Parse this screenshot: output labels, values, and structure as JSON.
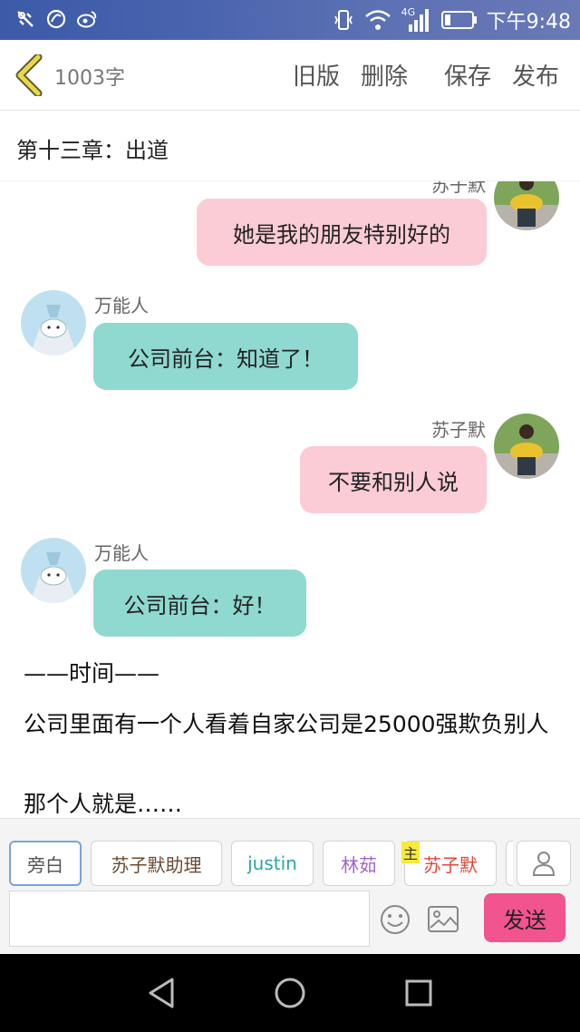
{
  "status_bar": {
    "network_label": "4G",
    "time": "下午9:48"
  },
  "header": {
    "word_count": "1003字",
    "actions": {
      "old_version": "旧版",
      "delete": "删除",
      "save": "保存",
      "publish": "发布"
    }
  },
  "chapter": {
    "title": "第十三章：出道"
  },
  "messages": [
    {
      "side": "right",
      "name": "苏子默",
      "text": "她是我的朋友特别好的"
    },
    {
      "side": "left",
      "name": "万能人",
      "text": "公司前台：知道了！"
    },
    {
      "side": "right",
      "name": "苏子默",
      "text": "不要和别人说"
    },
    {
      "side": "left",
      "name": "万能人",
      "text": "公司前台：好！"
    }
  ],
  "narration": [
    "——时间——",
    "公司里面有一个人看着自家公司是25000强欺负别人",
    "那个人就是……"
  ],
  "roles": [
    {
      "label": "旁白"
    },
    {
      "label": "苏子默助理"
    },
    {
      "label": "justin"
    },
    {
      "label": "林茹"
    },
    {
      "label": "苏子默"
    }
  ],
  "host_badge": "主",
  "send_label": "发送",
  "colors": {
    "pink_bubble": "#fbccd6",
    "teal_bubble": "#8fd9d0",
    "send_button": "#f2548f",
    "active_role_border": "#7aa3dc",
    "back_chevron": "#e8d84a"
  },
  "icons": {
    "back": "chevron-left-icon",
    "emoji": "smiley-icon",
    "image": "image-icon",
    "character": "person-icon",
    "nav_back": "triangle-back-icon",
    "nav_home": "circle-home-icon",
    "nav_recent": "square-recent-icon"
  }
}
